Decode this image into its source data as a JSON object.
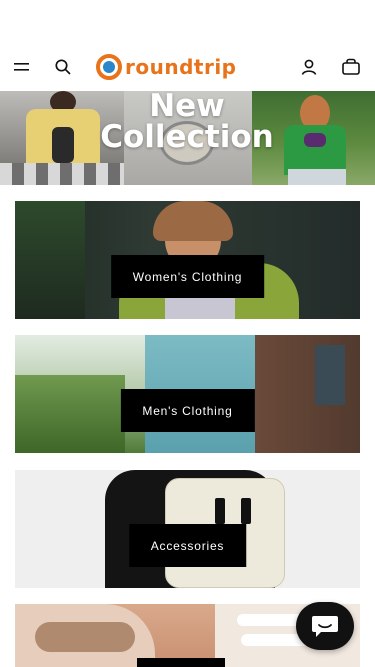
{
  "header": {
    "brand": "roundtrip",
    "brand_color": "#e8731a",
    "brand_mark_color": "#2b87c9",
    "icons": [
      "menu-icon",
      "search-icon",
      "account-icon",
      "cart-icon"
    ]
  },
  "hero": {
    "title_line1": "New",
    "title_line2": "Collection"
  },
  "categories": [
    {
      "label": "Women's Clothing"
    },
    {
      "label": "Men's Clothing"
    },
    {
      "label": "Accessories"
    }
  ],
  "chat": {
    "icon": "chat-icon"
  }
}
